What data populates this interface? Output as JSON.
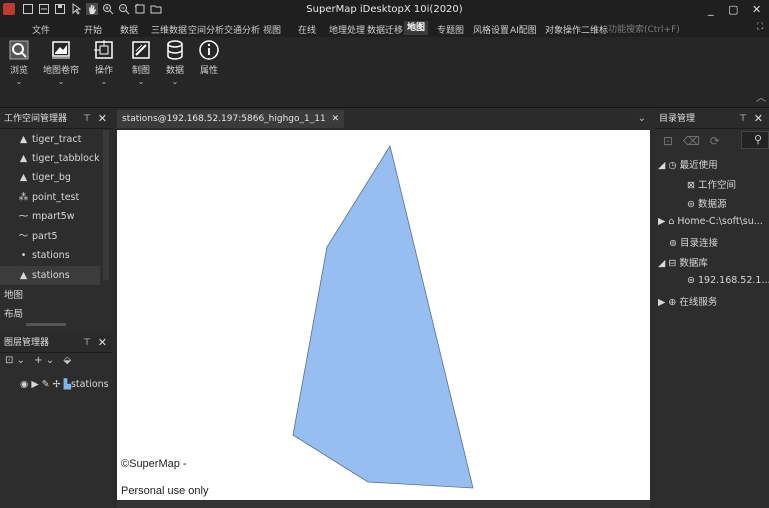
{
  "app": {
    "title": "SuperMap iDesktopX 10i(2020)"
  },
  "menu": {
    "items": [
      "文件",
      "开始",
      "数据",
      "三维数据",
      "空间分析",
      "交通分析",
      "视图",
      "在线",
      "地理处理",
      "数据迁移",
      "地图",
      "专题图",
      "风格设置",
      "AI配图",
      "对象操作",
      "二维标"
    ],
    "active": "地图",
    "search_placeholder": "功能搜索(Ctrl+F)"
  },
  "ribbon": {
    "buttons": [
      {
        "label": "浏览",
        "icon": "browse-icon"
      },
      {
        "label": "地图卷帘",
        "icon": "map-swipe-icon"
      },
      {
        "label": "操作",
        "icon": "operate-icon"
      },
      {
        "label": "制图",
        "icon": "drawing-icon"
      },
      {
        "label": "数据",
        "icon": "database-icon"
      },
      {
        "label": "属性",
        "icon": "info-icon"
      }
    ]
  },
  "workspace": {
    "title": "工作空间管理器",
    "items": [
      "tiger_tract",
      "tiger_tabblock",
      "tiger_bg",
      "point_test",
      "mpart5w",
      "part5",
      "stations",
      "stations"
    ],
    "sections": [
      "地图",
      "布局"
    ]
  },
  "layers": {
    "title": "图层管理器",
    "items": [
      "stations"
    ]
  },
  "document": {
    "tab_title": "stations@192.168.52.197:5866_highgo_1_11",
    "credit_line1": "©SuperMap -",
    "credit_line2": "Personal use only",
    "fill_color": "#96bef0",
    "stroke_color": "#5a6f8a"
  },
  "catalog": {
    "title": "目录管理",
    "recent": "最近使用",
    "workspace": "工作空间",
    "datasource": "数据源",
    "home": "Home-C:\\soft\\su...",
    "catalog_link": "目录连接",
    "database": "数据库",
    "db_host": "192.168.52.1...",
    "online": "在线服务"
  }
}
